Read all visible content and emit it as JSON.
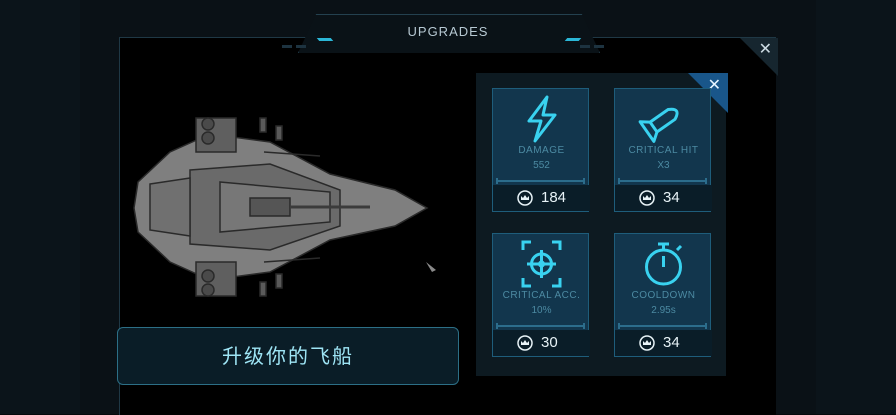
{
  "header": {
    "title": "UPGRADES",
    "close_symbol": "✕"
  },
  "caption": "升级你的飞船",
  "panel": {
    "close_symbol": "✕"
  },
  "upgrades": [
    {
      "icon": "lightning-icon",
      "label": "DAMAGE",
      "value": "552",
      "cost": "184"
    },
    {
      "icon": "missile-icon",
      "label": "CRITICAL HIT",
      "value": "X3",
      "cost": "34"
    },
    {
      "icon": "crosshair-icon",
      "label": "CRITICAL ACC.",
      "value": "10%",
      "cost": "30"
    },
    {
      "icon": "stopwatch-icon",
      "label": "COOLDOWN",
      "value": "2.95s",
      "cost": "34"
    }
  ],
  "colors": {
    "accent": "#2bb7d7",
    "card_bg": "#12364d",
    "close_blue": "#19568a",
    "caption_text": "#9ee5f5"
  }
}
